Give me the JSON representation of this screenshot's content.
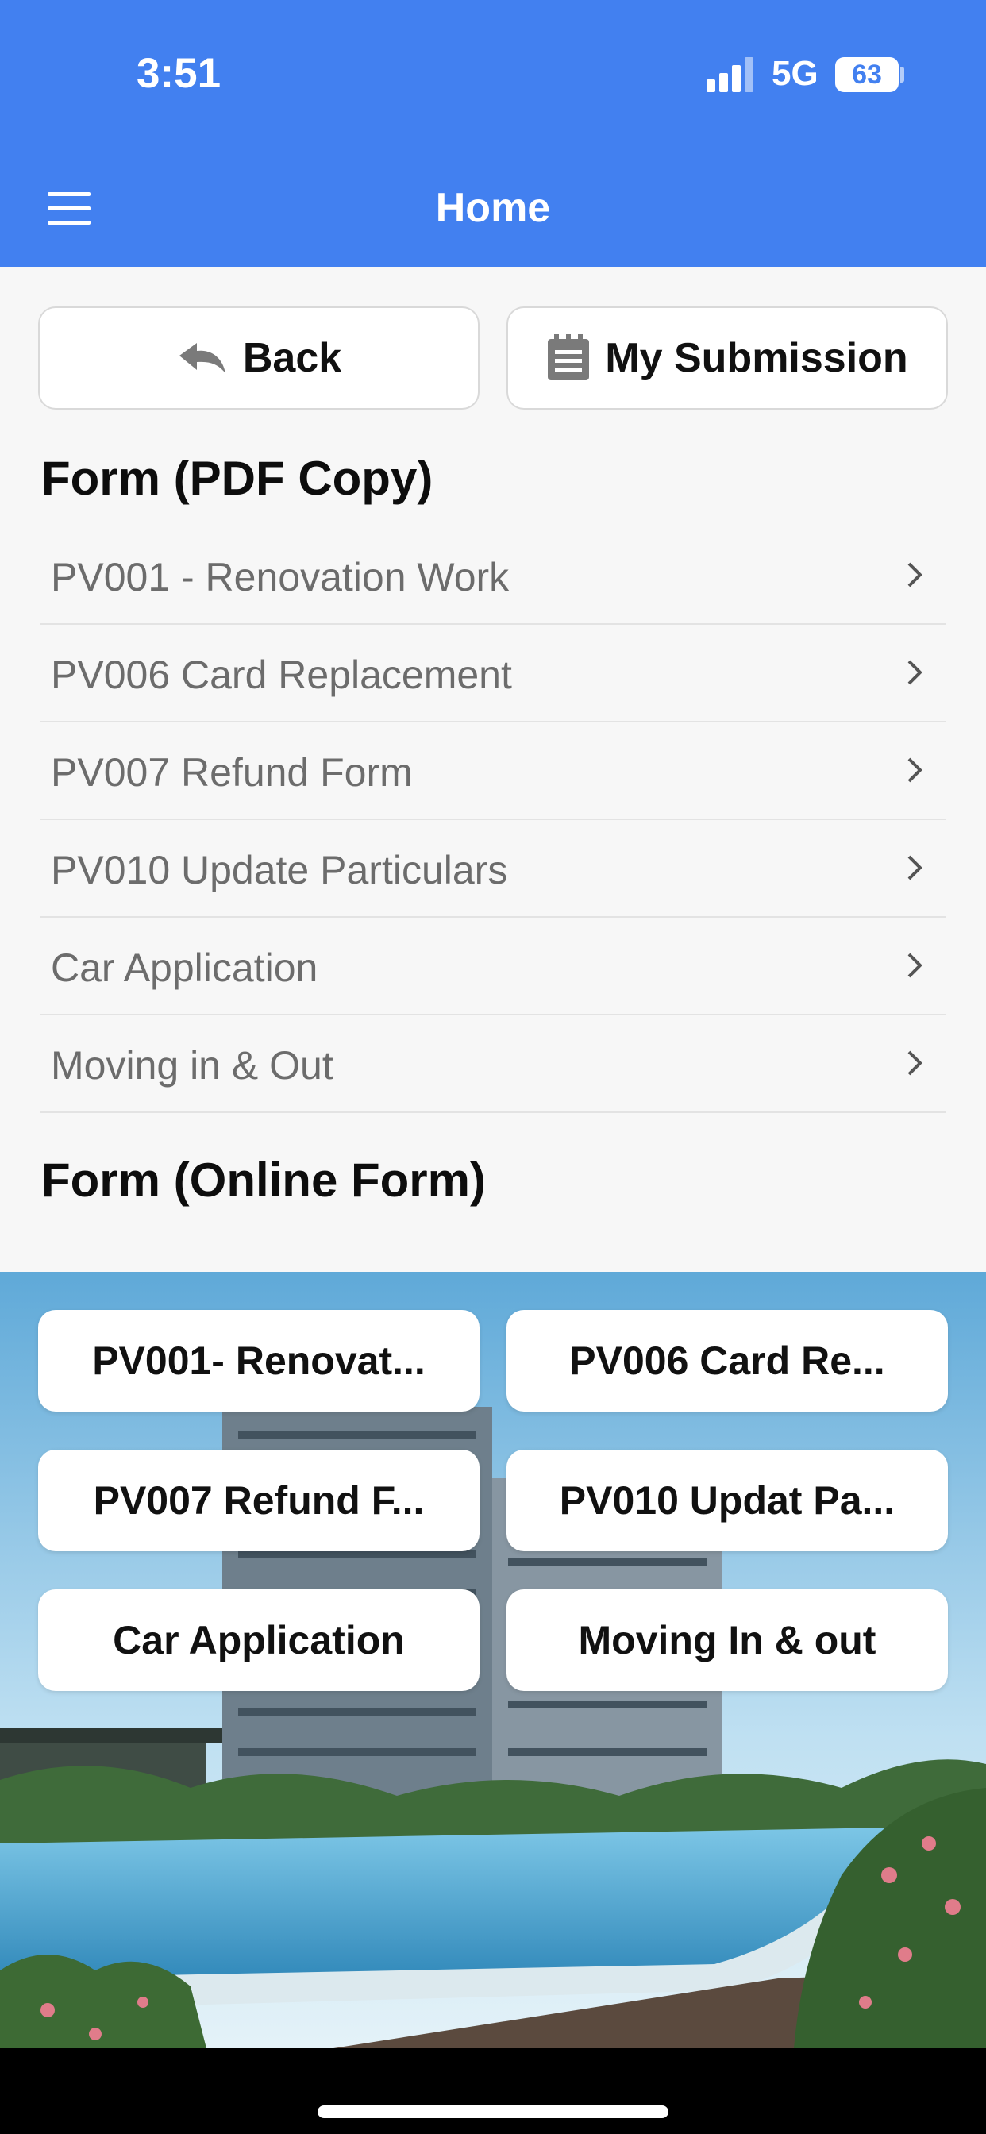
{
  "status_bar": {
    "time": "3:51",
    "network": "5G",
    "battery": "63",
    "icons": [
      "signal-icon",
      "battery-icon"
    ]
  },
  "nav_bar": {
    "title": "Home",
    "menu_icon": "hamburger-menu-icon",
    "color": "#4280f0"
  },
  "actions": {
    "back": {
      "label": "Back",
      "icon": "undo-arrow-icon"
    },
    "submission": {
      "label": "My Submission",
      "icon": "document-list-icon"
    }
  },
  "pdf_section": {
    "title": "Form (PDF Copy)",
    "items": [
      {
        "label": "PV001 - Renovation Work"
      },
      {
        "label": "PV006 Card Replacement"
      },
      {
        "label": "PV007 Refund Form"
      },
      {
        "label": "PV010 Update Particulars"
      },
      {
        "label": "Car Application"
      },
      {
        "label": "Moving in & Out"
      }
    ]
  },
  "online_section": {
    "title": "Form (Online Form)",
    "buttons": [
      {
        "label": "PV001- Renovat..."
      },
      {
        "label": "PV006 Card Re..."
      },
      {
        "label": "PV007 Refund F..."
      },
      {
        "label": "PV010 Updat Pa..."
      },
      {
        "label": "Car Application"
      },
      {
        "label": "Moving In & out"
      }
    ]
  }
}
